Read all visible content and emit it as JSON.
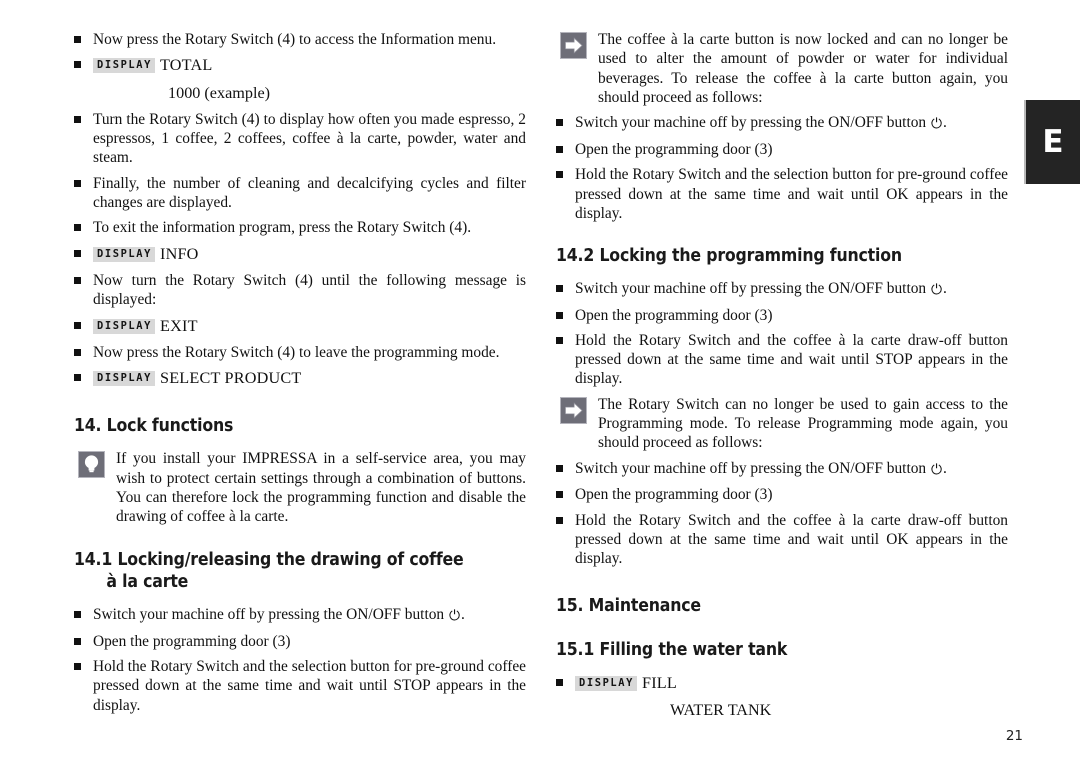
{
  "page": {
    "number": "21",
    "edge_tab_label": "E",
    "badge_label": "DISPLAY",
    "power_symbol": "⏻"
  },
  "left_column": {
    "blocks": [
      {
        "kind": "bullet",
        "text": "Now press the Rotary Switch (4) to access the Information menu."
      },
      {
        "kind": "display",
        "value": "TOTAL",
        "sub": "1000 (example)"
      },
      {
        "kind": "bullet",
        "text": "Turn the Rotary Switch (4) to display how often you made espresso, 2 espressos, 1 coffee, 2 coffees, coffee à la carte, powder, water and steam."
      },
      {
        "kind": "bullet",
        "text": "Finally, the number of cleaning and decalcifying cycles and filter changes are displayed."
      },
      {
        "kind": "bullet",
        "text": "To exit the information program, press the Rotary Switch (4)."
      },
      {
        "kind": "display",
        "value": "INFO"
      },
      {
        "kind": "bullet",
        "text": "Now turn the Rotary Switch (4) until the following message is displayed:"
      },
      {
        "kind": "display",
        "value": "EXIT"
      },
      {
        "kind": "bullet",
        "text": "Now press the Rotary Switch (4) to leave the programming mode."
      },
      {
        "kind": "display",
        "value": "SELECT PRODUCT"
      },
      {
        "kind": "heading",
        "text": "14. Lock functions"
      },
      {
        "kind": "note",
        "icon": "lightbulb-icon",
        "text": "If you install your IMPRESSA in a self-service area, you may wish to protect certain settings through a combination of buttons. You can therefore lock the programming function and disable the drawing of coffee à la carte."
      },
      {
        "kind": "heading2",
        "text": "14.1 Locking/releasing the drawing of coffee",
        "continuation": "à la carte"
      },
      {
        "kind": "bullet_power",
        "before": "Switch your machine off by pressing the ON/OFF button ",
        "after": "."
      },
      {
        "kind": "bullet",
        "text": "Open the programming door (3)"
      },
      {
        "kind": "bullet",
        "text": "Hold the Rotary Switch and the selection button for pre-ground coffee pressed down at the same time and wait until STOP appears in the display."
      }
    ]
  },
  "right_column": {
    "blocks": [
      {
        "kind": "note",
        "icon": "arrow-right-icon",
        "text": "The coffee à la carte button is now locked and can no longer be used to alter the amount of powder or water for individual beverages. To release the coffee à la carte button again, you should proceed as follows:"
      },
      {
        "kind": "bullet_power",
        "before": "Switch your machine off by pressing the ON/OFF button ",
        "after": "."
      },
      {
        "kind": "bullet",
        "text": "Open the programming door (3)"
      },
      {
        "kind": "bullet",
        "text": "Hold the Rotary Switch and the selection button for pre-ground coffee pressed down at the same time and wait until OK appears in the display."
      },
      {
        "kind": "heading2",
        "text": "14.2 Locking the programming function"
      },
      {
        "kind": "bullet_power",
        "before": "Switch your machine off by pressing the ON/OFF button ",
        "after": "."
      },
      {
        "kind": "bullet",
        "text": "Open the programming door (3)"
      },
      {
        "kind": "bullet",
        "text": "Hold the Rotary Switch and the coffee à la carte draw-off button pressed down at the same time and wait until STOP appears in the display."
      },
      {
        "kind": "note",
        "icon": "arrow-right-icon",
        "text": "The Rotary Switch can no longer be used to gain access to the Programming mode. To release Programming mode again, you should proceed as follows:"
      },
      {
        "kind": "bullet_power",
        "before": "Switch your machine off by pressing the ON/OFF button ",
        "after": "."
      },
      {
        "kind": "bullet",
        "text": "Open the programming door (3)"
      },
      {
        "kind": "bullet",
        "text": "Hold the Rotary Switch and the coffee à la carte draw-off button pressed down at the same time and wait until OK appears in the display."
      },
      {
        "kind": "heading",
        "text": "15. Maintenance"
      },
      {
        "kind": "heading2",
        "text": "15.1 Filling the water tank"
      },
      {
        "kind": "display",
        "value": "FILL",
        "sub2": "WATER TANK"
      }
    ]
  }
}
